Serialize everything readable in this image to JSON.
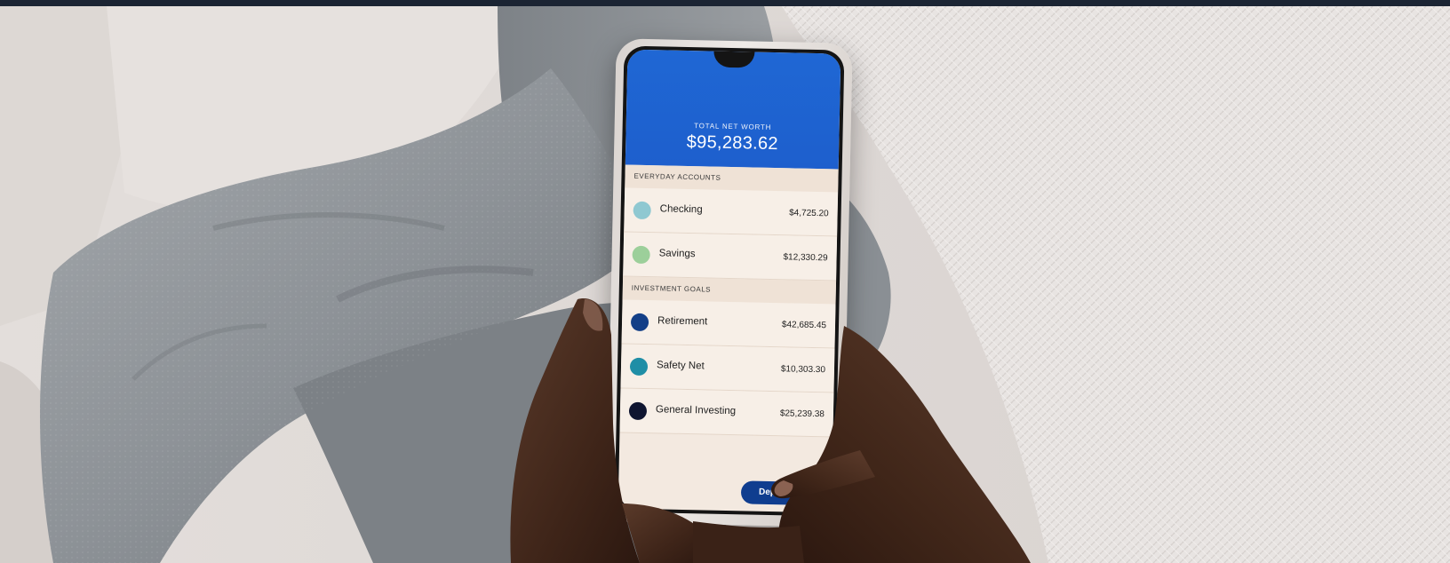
{
  "app": {
    "net_worth_label": "TOTAL NET WORTH",
    "net_worth_value": "$95,283.62",
    "sections": [
      {
        "title": "EVERYDAY ACCOUNTS",
        "items": [
          {
            "name": "Checking",
            "amount": "$4,725.20",
            "color": "#8fc8d1"
          },
          {
            "name": "Savings",
            "amount": "$12,330.29",
            "color": "#9ccf9a"
          }
        ]
      },
      {
        "title": "INVESTMENT GOALS",
        "items": [
          {
            "name": "Retirement",
            "amount": "$42,685.45",
            "color": "#133f87"
          },
          {
            "name": "Safety Net",
            "amount": "$10,303.30",
            "color": "#1f8ea6"
          },
          {
            "name": "General Investing",
            "amount": "$25,239.38",
            "color": "#0f1530"
          }
        ]
      }
    ],
    "deposit_label": "Dep"
  },
  "colors": {
    "header_blue": "#1f67d4",
    "button_navy": "#0f3d8f",
    "top_bar": "#1b2433"
  }
}
